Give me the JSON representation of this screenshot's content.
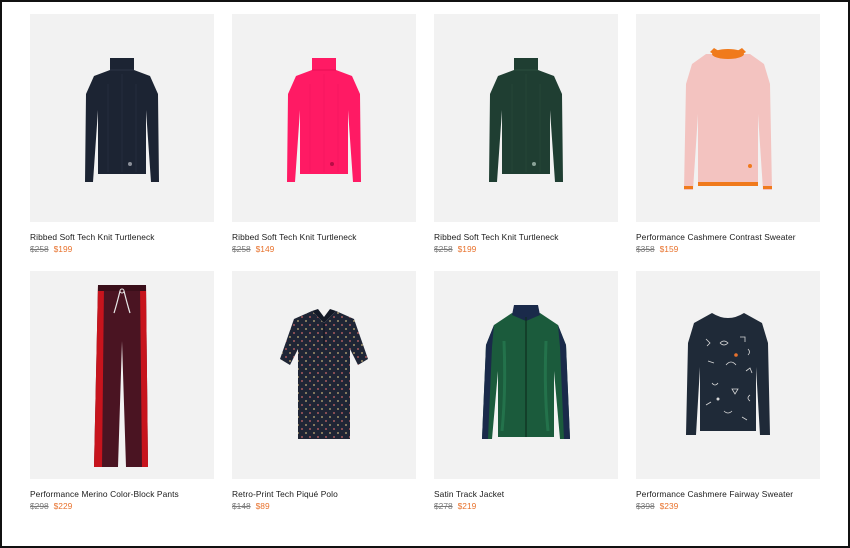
{
  "products": [
    {
      "name": "Ribbed Soft Tech Knit Turtleneck",
      "original_price": "$258",
      "sale_price": "$199",
      "color": "#1c2433"
    },
    {
      "name": "Ribbed Soft Tech Knit Turtleneck",
      "original_price": "$258",
      "sale_price": "$149",
      "color": "#ff1a64"
    },
    {
      "name": "Ribbed Soft Tech Knit Turtleneck",
      "original_price": "$258",
      "sale_price": "$199",
      "color": "#1f3e32"
    },
    {
      "name": "Performance Cashmere Contrast Sweater",
      "original_price": "$358",
      "sale_price": "$159",
      "color": "#f3c3c0"
    },
    {
      "name": "Performance Merino Color-Block Pants",
      "original_price": "$298",
      "sale_price": "$229",
      "color": "#4a1422"
    },
    {
      "name": "Retro-Print Tech Piqué Polo",
      "original_price": "$148",
      "sale_price": "$89",
      "color": "#1f2535"
    },
    {
      "name": "Satin Track Jacket",
      "original_price": "$278",
      "sale_price": "$219",
      "color": "#1b5b3c"
    },
    {
      "name": "Performance Cashmere Fairway Sweater",
      "original_price": "$398",
      "sale_price": "$239",
      "color": "#1f2a38"
    }
  ],
  "colors": {
    "sale": "#e8722d",
    "original": "#7a7a7a",
    "thumb_bg": "#f2f2f2"
  }
}
